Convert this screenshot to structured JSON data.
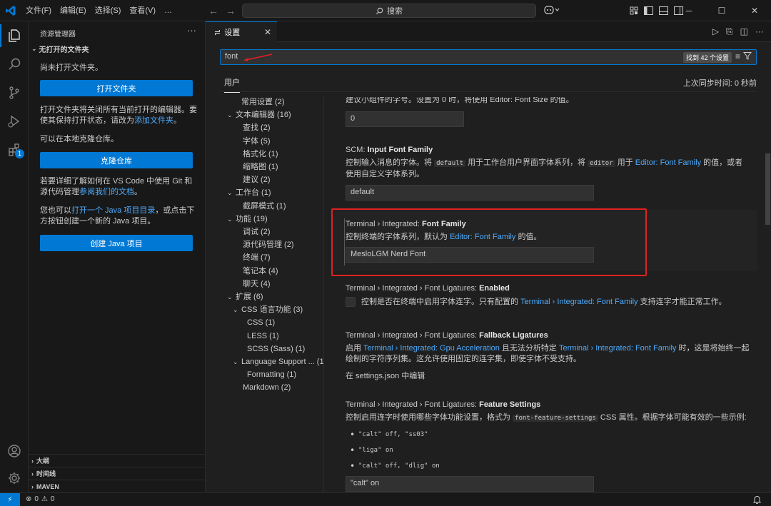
{
  "titlebar": {
    "menus": [
      "文件(F)",
      "编辑(E)",
      "选择(S)",
      "查看(V)",
      "…"
    ],
    "search_label": "搜索"
  },
  "sidebar": {
    "title": "资源管理器",
    "more": "···",
    "section": "无打开的文件夹",
    "no_folder_text": "尚未打开文件夹。",
    "open_folder_button": "打开文件夹",
    "close_editors_text": "打开文件夹将关闭所有当前打开的编辑器。要使其保持打开状态，请改为",
    "add_folder_link": "添加文件夹",
    "period": "。",
    "clone_text": "可以在本地克隆仓库。",
    "clone_button": "克隆仓库",
    "git_text": "若要详细了解如何在 VS Code 中使用 Git 和源代码管理",
    "git_link": "参阅我们的文档",
    "java_text_1": "您也可以",
    "java_link": "打开一个 Java 项目目录",
    "java_text_2": "，或点击下方按钮创建一个新的 Java 项目。",
    "java_button": "创建 Java 项目",
    "bottom_sections": [
      "大纲",
      "时间线",
      "MAVEN"
    ]
  },
  "activity": {
    "extensions_badge": "1"
  },
  "editor": {
    "tab_label": "设置",
    "search_value": "font",
    "search_count": "找到 42 个设置",
    "scope_user": "用户",
    "sync_time": "上次同步时间: 0 秒前"
  },
  "toc": [
    {
      "label": "常用设置 (2)",
      "level": 1,
      "chevron": ""
    },
    {
      "label": "文本编辑器 (16)",
      "level": 0,
      "chevron": "⌄"
    },
    {
      "label": "查找 (2)",
      "level": 2,
      "chevron": ""
    },
    {
      "label": "字体 (5)",
      "level": 2,
      "chevron": ""
    },
    {
      "label": "格式化 (1)",
      "level": 2,
      "chevron": ""
    },
    {
      "label": "缩略图 (1)",
      "level": 2,
      "chevron": ""
    },
    {
      "label": "建议 (2)",
      "level": 2,
      "chevron": ""
    },
    {
      "label": "工作台 (1)",
      "level": 0,
      "chevron": "⌄"
    },
    {
      "label": "截屏模式 (1)",
      "level": 2,
      "chevron": ""
    },
    {
      "label": "功能 (19)",
      "level": 0,
      "chevron": "⌄"
    },
    {
      "label": "调试 (2)",
      "level": 2,
      "chevron": ""
    },
    {
      "label": "源代码管理 (2)",
      "level": 2,
      "chevron": ""
    },
    {
      "label": "终端 (7)",
      "level": 2,
      "chevron": ""
    },
    {
      "label": "笔记本 (4)",
      "level": 2,
      "chevron": ""
    },
    {
      "label": "聊天 (4)",
      "level": 2,
      "chevron": ""
    },
    {
      "label": "扩展 (6)",
      "level": 0,
      "chevron": "⌄"
    },
    {
      "label": "CSS 语言功能 (3)",
      "level": 1,
      "chevron": "⌄"
    },
    {
      "label": "CSS (1)",
      "level": 3,
      "chevron": ""
    },
    {
      "label": "LESS (1)",
      "level": 3,
      "chevron": ""
    },
    {
      "label": "SCSS (Sass) (1)",
      "level": 3,
      "chevron": ""
    },
    {
      "label": "Language Support ... (1)",
      "level": 1,
      "chevron": "⌄"
    },
    {
      "label": "Formatting (1)",
      "level": 3,
      "chevron": ""
    },
    {
      "label": "Markdown (2)",
      "level": 2,
      "chevron": ""
    }
  ],
  "settings": {
    "partial_desc": "建议小组件的字号。设置为 0 时，将使用 Editor: Font Size 的值。",
    "partial_input": "0",
    "scm": {
      "title_prefix": "SCM: ",
      "title_bold": "Input Font Family",
      "desc_1": "控制输入消息的字体。将",
      "code_1": "default",
      "desc_2": "用于工作台用户界面字体系列，将",
      "code_2": "editor",
      "desc_3": "用于",
      "link": "Editor: Font Family",
      "desc_4": "的值，或者使用自定义字体系列。",
      "value": "default"
    },
    "term_font": {
      "title_prefix": "Terminal › Integrated: ",
      "title_bold": "Font Family",
      "desc_1": "控制终端的字体系列，默认为",
      "link": "Editor: Font Family",
      "desc_2": "的值。",
      "value": "MesloLGM Nerd Font"
    },
    "ligatures_enabled": {
      "title_prefix": "Terminal › Integrated › Font Ligatures: ",
      "title_bold": "Enabled",
      "desc_1": "控制是否在终端中启用字体连字。只有配置的",
      "link": "Terminal › Integrated: Font Family",
      "desc_2": "支持连字才能正常工作。"
    },
    "ligatures_fallback": {
      "title_prefix": "Terminal › Integrated › Font Ligatures: ",
      "title_bold": "Fallback Ligatures",
      "desc_1": "启用",
      "link_1": "Terminal › Integrated: Gpu Acceleration",
      "desc_2": "且无法分析特定",
      "link_2": "Terminal › Integrated: Font Family",
      "desc_3": "时，这是将始终一起绘制的字符序列集。这允许使用固定的连字集，即使字体不受支持。",
      "json_link": "在 settings.json 中编辑"
    },
    "ligatures_features": {
      "title_prefix": "Terminal › Integrated › Font Ligatures: ",
      "title_bold": "Feature Settings",
      "desc_1": "控制启用连字时使用哪些字体功能设置，格式为",
      "code": "font-feature-settings",
      "desc_2": "CSS 属性。根据字体可能有效的一些示例:",
      "examples": [
        "\"calt\" off, \"ss03\"",
        "\"liga\" on",
        "\"calt\" off, \"dlig\" on"
      ],
      "value": "\"calt\" on"
    }
  },
  "statusbar": {
    "errors": "0",
    "warnings": "0"
  },
  "colors": {
    "accent": "#0078d4",
    "link": "#4daafc",
    "annotation_red": "#e02020"
  }
}
